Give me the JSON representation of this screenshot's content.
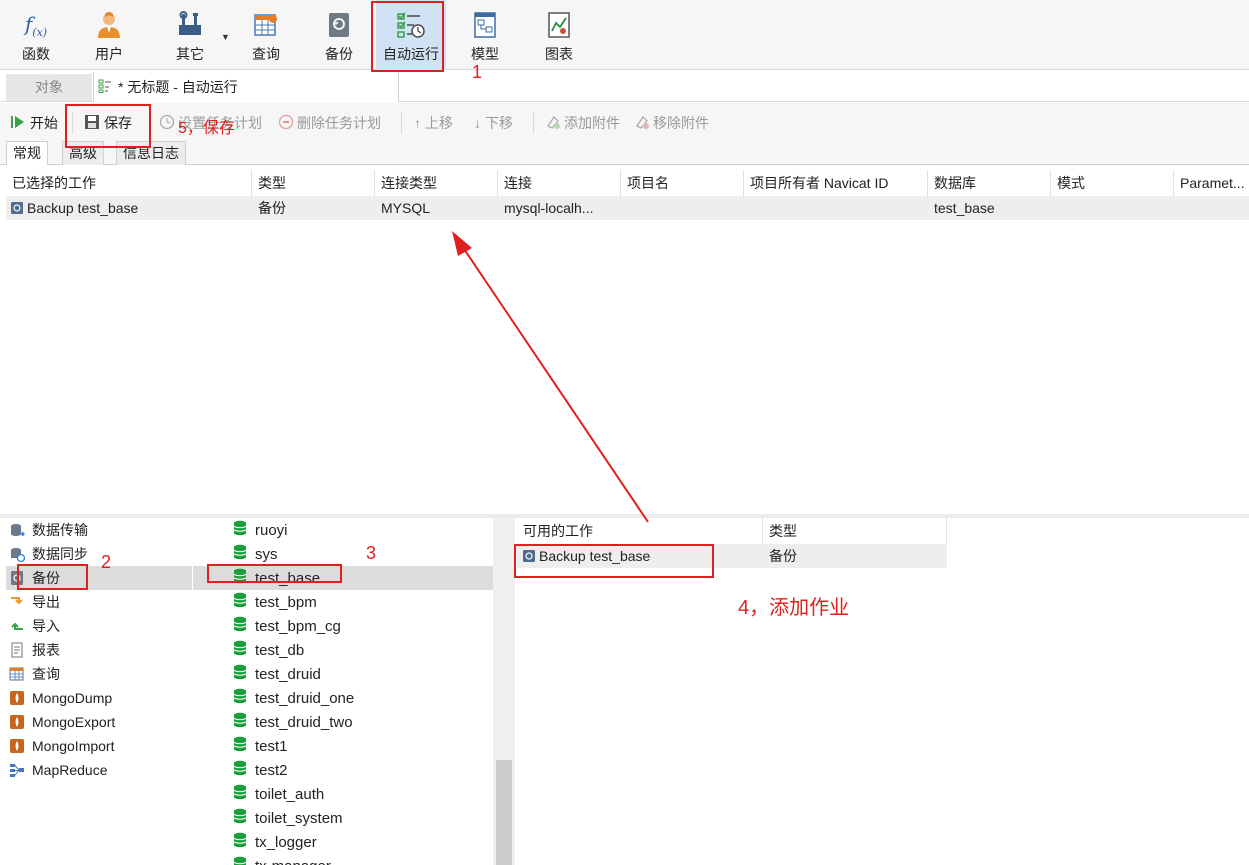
{
  "ribbon": {
    "buttons": [
      {
        "label": "函数",
        "icon": "function-icon"
      },
      {
        "label": "用户",
        "icon": "user-icon"
      },
      {
        "label": "其它",
        "icon": "tools-icon"
      },
      {
        "label": "查询",
        "icon": "query-icon"
      },
      {
        "label": "备份",
        "icon": "backup-icon"
      },
      {
        "label": "自动运行",
        "icon": "automation-icon",
        "active": true
      },
      {
        "label": "模型",
        "icon": "model-icon"
      },
      {
        "label": "图表",
        "icon": "chart-icon"
      }
    ]
  },
  "tabs": {
    "objects_label": "对象",
    "doc_title": "* 无标题 - 自动运行"
  },
  "toolbar": {
    "start": "开始",
    "save": "保存",
    "set_schedule": "设置任务计划",
    "delete_schedule": "删除任务计划",
    "move_up": "上移",
    "move_down": "下移",
    "add_attachment": "添加附件",
    "remove_attachment": "移除附件"
  },
  "subtabs": [
    "常规",
    "高级",
    "信息日志"
  ],
  "selected_jobs": {
    "columns": [
      "已选择的工作",
      "类型",
      "连接类型",
      "连接",
      "项目名",
      "项目所有者 Navicat ID",
      "数据库",
      "模式",
      "Paramet..."
    ],
    "rows": [
      [
        "Backup test_base",
        "备份",
        "MYSQL",
        "mysql-localh...",
        "",
        "",
        "test_base",
        "",
        ""
      ]
    ]
  },
  "job_categories": [
    {
      "label": "数据传输",
      "icon": "data-transfer-icon"
    },
    {
      "label": "数据同步",
      "icon": "data-sync-icon"
    },
    {
      "label": "备份",
      "icon": "backup-icon",
      "selected": true
    },
    {
      "label": "导出",
      "icon": "export-icon"
    },
    {
      "label": "导入",
      "icon": "import-icon"
    },
    {
      "label": "报表",
      "icon": "report-icon"
    },
    {
      "label": "查询",
      "icon": "query-icon"
    },
    {
      "label": "MongoDump",
      "icon": "mongo-icon"
    },
    {
      "label": "MongoExport",
      "icon": "mongo-icon"
    },
    {
      "label": "MongoImport",
      "icon": "mongo-icon"
    },
    {
      "label": "MapReduce",
      "icon": "mapreduce-icon"
    }
  ],
  "databases": [
    "ruoyi",
    "sys",
    "test_base",
    "test_bpm",
    "test_bpm_cg",
    "test_db",
    "test_druid",
    "test_druid_one",
    "test_druid_two",
    "test1",
    "test2",
    "toilet_auth",
    "toilet_system",
    "tx_logger",
    "tx-manager"
  ],
  "selected_database": "test_base",
  "available_jobs": {
    "columns": [
      "可用的工作",
      "类型"
    ],
    "rows": [
      [
        "Backup test_base",
        "备份"
      ]
    ]
  },
  "annotations": {
    "step1": "1",
    "step2": "2",
    "step3": "3",
    "step4": "4，添加作业",
    "step5": "5，保存"
  },
  "colors": {
    "annotation": "#e0201f",
    "active_button": "#cfe3f5",
    "db_icon": "#1f9d3a"
  }
}
